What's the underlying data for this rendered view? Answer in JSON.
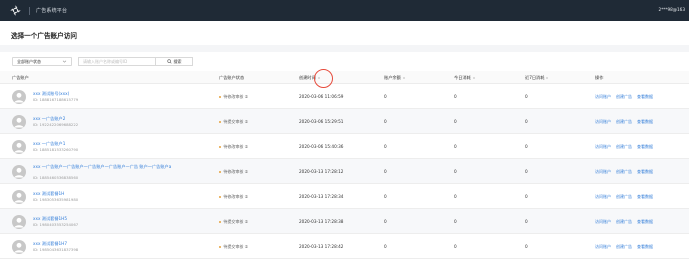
{
  "topbar": {
    "brand_title": "广告系统平台",
    "user_name": "2***98@163",
    "logo_icon": "brand-logo-icon"
  },
  "page_title": "选择一个广告账户访问",
  "filters": {
    "status_select_value": "全部账户状态",
    "search_placeholder": "请输入账户名称或编号ID",
    "search_button": "搜索"
  },
  "table": {
    "columns": {
      "account": "广告账户",
      "status": "广告账户状态",
      "created": "创建时间",
      "balance": "账户余额",
      "spend_today": "今日消耗",
      "spend_7d": "近7日消耗",
      "ops": "操作"
    },
    "op_labels": [
      "访问账户",
      "创建广告",
      "查看数据"
    ],
    "rows": [
      {
        "name": "xxx 测试账号(xxx)",
        "id": "ID: 1888167188615779",
        "status": "待修改审核 ②",
        "created": "2020-03-06 11:06:59",
        "balance": "0",
        "spend_today": "0",
        "spend_7d": "0"
      },
      {
        "name": "xxx 一广告账户2",
        "id": "ID: 1922422069688222",
        "status": "待提交审核 ②",
        "created": "2020-03-06 15:29:51",
        "balance": "0",
        "spend_today": "0",
        "spend_7d": "0"
      },
      {
        "name": "xxx 一广告账户1",
        "id": "ID: 1885181533260790",
        "status": "待修改审核 ②",
        "created": "2020-03-06 15:40:36",
        "balance": "0",
        "spend_today": "0",
        "spend_7d": "0"
      },
      {
        "name": "xxx 一广告账户一广告账户一广告账户一广告账户一广告 账户一广告账户a",
        "id": "ID: 1885460536838560",
        "status": "待修改审核 ②",
        "created": "2020-03-13 17:28:12",
        "balance": "0",
        "spend_today": "0",
        "spend_7d": "0"
      },
      {
        "name": "xxx 测试套餐1H",
        "id": "ID: 1983053635981980",
        "status": "待修改审核 ②",
        "created": "2020-03-13 17:28:34",
        "balance": "0",
        "spend_today": "0",
        "spend_7d": "0"
      },
      {
        "name": "xxx 测试套餐1H5",
        "id": "ID: 1980403553254067",
        "status": "待提交审核 ②",
        "created": "2020-03-13 17:28:38",
        "balance": "0",
        "spend_today": "0",
        "spend_7d": "0"
      },
      {
        "name": "xxx 测试套餐1H7",
        "id": "ID: 1985043631837398",
        "status": "待提交审核 ②",
        "created": "2020-03-13 17:28:42",
        "balance": "0",
        "spend_today": "0",
        "spend_7d": "0"
      }
    ]
  },
  "colors": {
    "topbar": "#1f2a36",
    "link": "#2f7bd8",
    "status_dot": "#e6a23c",
    "highlight_circle": "#e64b3c"
  }
}
